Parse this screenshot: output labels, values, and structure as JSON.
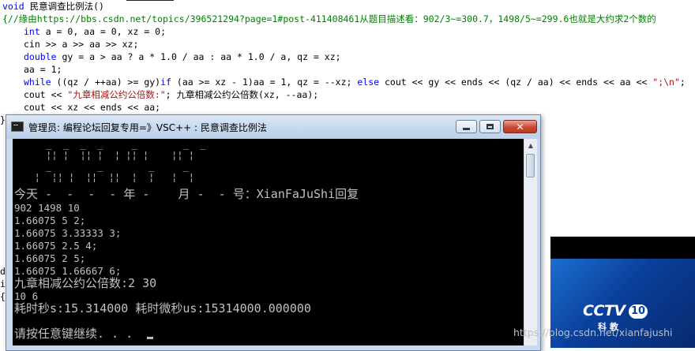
{
  "editor": {
    "lines": [
      {
        "type": "fn_sig",
        "kw": "void",
        "text": " 民意调查比例法()"
      },
      {
        "type": "comment",
        "text": "{//缘由https://bbs.csdn.net/topics/396521294?page=1#post-411408461从题目描述看：902/3~=300.7，1498/5~=299.6也就是大约求2个数的"
      },
      {
        "type": "decl",
        "kw": "int",
        "text": " a = 0, aa = 0, xz = 0;"
      },
      {
        "type": "plain",
        "text": "cin >> a >> aa >> xz;"
      },
      {
        "type": "decl",
        "kw": "double",
        "text": " gy = a > aa ? a * 1.0 / aa : aa * 1.0 / a, qz = xz;"
      },
      {
        "type": "plain",
        "text": "aa = 1;"
      },
      {
        "type": "while",
        "kw": "while",
        "mid": " ((qz / ++aa) >= gy)",
        "kw2": "if",
        "mid2": " (aa >= xz - 1)aa = 1, qz = --xz; ",
        "kw3": "else",
        "tail": " cout << gy << ends << (qz / aa) << ends << aa << ",
        "str": "\";\\n\"",
        "end": ";"
      },
      {
        "type": "cout",
        "pre": "cout << ",
        "str": "\"九章相减公约公倍数:\"",
        "post": "; 九章相减公约公倍数(xz, --aa);"
      },
      {
        "type": "plain",
        "text": "cout << xz << ends << aa;"
      },
      {
        "type": "plain",
        "text": "}"
      }
    ],
    "left_fragments": [
      "d",
      "i",
      "{"
    ]
  },
  "console": {
    "title": "管理员:  编程论坛回复专用=》VSC++ : 民意调查比例法",
    "ascii_art": [
      "     _  _  _  _     _        _  _",
      "     ¦¦ ¦  ¦¦ ¦  ¦ ¦¦ ¦    ¦¦ ¦",
      "     _        _        _     _",
      "   ¦  ¦¦ ¦  ¦¦  ¦¦  ¦  ¦   ¦  ¦"
    ],
    "date_line": "今天 -  -  -  - 年 -    月 -  - 号：XianFaJuShi回复",
    "output_lines": [
      "902 1498 10",
      "1.66075 5 2;",
      "1.66075 3.33333 3;",
      "1.66075 2.5 4;",
      "1.66075 2 5;",
      "1.66075 1.66667 6;"
    ],
    "result_title": "九章相减公约公倍数:2 30",
    "result_values": "10 6",
    "timing": "耗时秒s:15.314000 耗时微秒us:15314000.000000",
    "prompt": "请按任意键继续. . ."
  },
  "video": {
    "logo": "CCTV",
    "channel": "10",
    "channel_name": "科教"
  },
  "watermark": "https://blog.csdn.net/xianfajushi",
  "colors": {
    "keyword": "#0000ff",
    "comment": "#008000",
    "string": "#a31515",
    "console_bg": "#000000",
    "console_text": "#c0c0c0",
    "titlebar": "#c5d7ee",
    "close_button": "#c94a33"
  }
}
